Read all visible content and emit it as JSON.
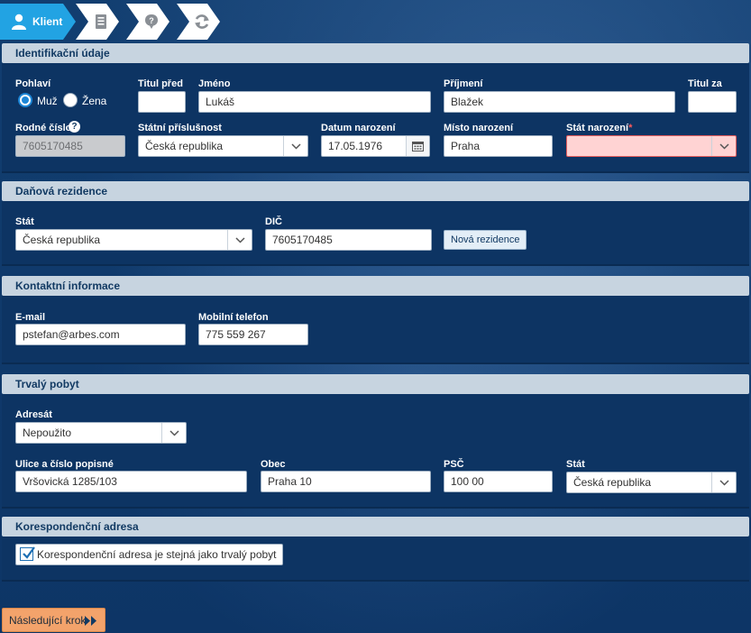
{
  "wizard": {
    "active_step": "Klient",
    "steps": [
      {
        "icon": "user-icon"
      },
      {
        "icon": "document-icon"
      },
      {
        "icon": "question-bubble-icon"
      },
      {
        "icon": "refresh-icon"
      }
    ]
  },
  "identifikace": {
    "title": "Identifikační údaje",
    "gender_label": "Pohlaví",
    "gender_options": [
      "Muž",
      "Žena"
    ],
    "gender_selected": "Muž",
    "titul_pred_label": "Titul před",
    "titul_pred_value": "",
    "jmeno_label": "Jméno",
    "jmeno_value": "Lukáš",
    "prijmeni_label": "Příjmení",
    "prijmeni_value": "Blažek",
    "titul_za_label": "Titul za",
    "titul_za_value": "",
    "rodne_cislo_label": "Rodné číslo",
    "rodne_cislo_help": "?",
    "rodne_cislo_value": "7605170485",
    "statni_prislusnost_label": "Státní příslušnost",
    "statni_prislusnost_value": "Česká republika",
    "datum_narozeni_label": "Datum narození",
    "datum_narozeni_value": "17.05.1976",
    "misto_narozeni_label": "Místo narození",
    "misto_narozeni_value": "Praha",
    "stat_narozeni_label": "Stát narození",
    "stat_narozeni_required": "*",
    "stat_narozeni_value": ""
  },
  "danova_rezidence": {
    "title": "Daňová rezidence",
    "stat_label": "Stát",
    "stat_value": "Česká republika",
    "dic_label": "DIČ",
    "dic_value": "7605170485",
    "nova_rezidence_button": "Nová rezidence"
  },
  "kontakt": {
    "title": "Kontaktní informace",
    "email_label": "E-mail",
    "email_value": "pstefan@arbes.com",
    "telefon_label": "Mobilní telefon",
    "telefon_value": "775 559 267"
  },
  "trvaly_pobyt": {
    "title": "Trvalý pobyt",
    "adresat_label": "Adresát",
    "adresat_value": "Nepoužito",
    "ulice_label": "Ulice a číslo popisné",
    "ulice_value": "Vršovická 1285/103",
    "obec_label": "Obec",
    "obec_value": "Praha 10",
    "psc_label": "PSČ",
    "psc_value": "100 00",
    "stat_label": "Stát",
    "stat_value": "Česká republika"
  },
  "korespondencni": {
    "title": "Korespondenční adresa",
    "same_checkbox_label": "Korespondenční adresa je stejná jako trvalý pobyt",
    "same_checked": true
  },
  "footer": {
    "next_button": "Následující krok"
  },
  "colors": {
    "accent": "#22a3e3",
    "section_header": "#c7d4e0",
    "panel": "#0d3463",
    "error_fill": "#ffd3d3",
    "next_button": "#f3a36b"
  }
}
